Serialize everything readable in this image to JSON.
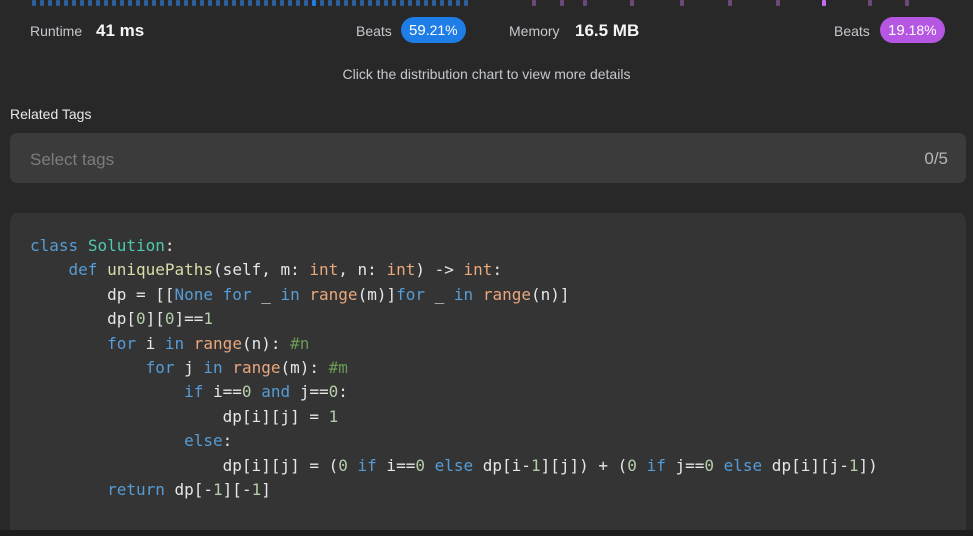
{
  "stats": {
    "runtime_label": "Runtime",
    "runtime_value": "41 ms",
    "runtime_beats_label": "Beats",
    "runtime_beats_int": "59",
    "runtime_beats_dec": ".21%",
    "memory_label": "Memory",
    "memory_value": "16.5 MB",
    "memory_beats_label": "Beats",
    "memory_beats_int": "19",
    "memory_beats_dec": ".18%"
  },
  "hint": "Click the distribution chart to view more details",
  "related_tags": {
    "label": "Related Tags",
    "placeholder": "Select tags",
    "count": "0/5"
  },
  "colors": {
    "runtime_badge": "#1e7de6",
    "memory_badge": "#b557e3",
    "runtime_bars": "#2f5f9e",
    "runtime_bar_highlight": "#1e7de6",
    "memory_bars": "#6a4a7a",
    "memory_bar_highlight": "#c46cf0"
  },
  "code": {
    "line1": {
      "kw": "class",
      "name": "Solution",
      "rest": ":"
    },
    "line2": {
      "kw": "def",
      "fn": "uniquePaths",
      "a": "(self, m: ",
      "t1": "int",
      "b": ", n: ",
      "t2": "int",
      "c": ") -> ",
      "t3": "int",
      "d": ":"
    },
    "line3": {
      "a": "dp = [[",
      "none": "None",
      "sp": " ",
      "for1": "for",
      "b": " _ ",
      "in1": "in",
      "sp2": " ",
      "r1": "range",
      "c": "(m)]",
      "for2": "for",
      "d": " _ ",
      "in2": "in",
      "sp3": " ",
      "r2": "range",
      "e": "(n)]"
    },
    "line4": {
      "a": "dp[",
      "z1": "0",
      "b": "][",
      "z2": "0",
      "c": "]==",
      "one": "1"
    },
    "line5": {
      "for": "for",
      "a": " i ",
      "in": "in",
      "sp": " ",
      "r": "range",
      "b": "(n): ",
      "cm": "#n"
    },
    "line6": {
      "for": "for",
      "a": " j ",
      "in": "in",
      "sp": " ",
      "r": "range",
      "b": "(m): ",
      "cm": "#m"
    },
    "line7": {
      "if": "if",
      "a": " i==",
      "z1": "0",
      "sp": " ",
      "and": "and",
      "b": " j==",
      "z2": "0",
      "c": ":"
    },
    "line8": {
      "a": "dp[i][j] = ",
      "one": "1"
    },
    "line9": {
      "else": "else",
      "a": ":"
    },
    "line10": {
      "a": "dp[i][j] = (",
      "z1": "0",
      "sp1": " ",
      "if1": "if",
      "b": " i==",
      "z2": "0",
      "sp2": " ",
      "else1": "else",
      "c": " dp[i-",
      "o1": "1",
      "d": "][j]) + (",
      "z3": "0",
      "sp3": " ",
      "if2": "if",
      "e": " j==",
      "z4": "0",
      "sp4": " ",
      "else2": "else",
      "f": " dp[i][j-",
      "o2": "1",
      "g": "])"
    },
    "line11": {
      "ret": "return",
      "a": " dp[-",
      "o1": "1",
      "b": "][-",
      "o2": "1",
      "c": "]"
    }
  }
}
